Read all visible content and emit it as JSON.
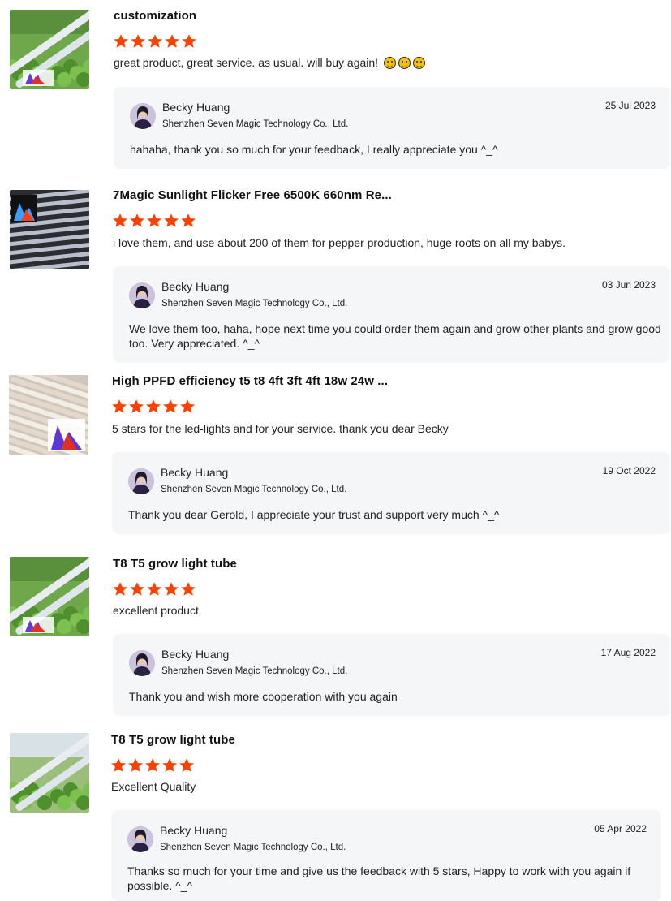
{
  "colors": {
    "star": "#ff4000",
    "reply_bg": "#f5f6f8"
  },
  "reviews": [
    {
      "title": "customization",
      "rating": 5,
      "comment": "great product, great service. as usual. will buy again!",
      "emoji_count": 3,
      "thumbnail_icon": "grow-light-tubes-with-plants",
      "reply": {
        "name": "Becky Huang",
        "company": "Shenzhen Seven Magic Technology Co., Ltd.",
        "date": "25 Jul 2023",
        "text_lines": [
          "hahaha, thank you so much for your feedback, I really appreciate you ^_^"
        ]
      }
    },
    {
      "title": "7Magic Sunlight Flicker Free 6500K 660nm Re...",
      "rating": 5,
      "comment": "i love them, and use about 200 of them for pepper production, huge roots on all my babys.",
      "emoji_count": 0,
      "thumbnail_icon": "grow-light-bars-dark",
      "reply": {
        "name": "Becky Huang",
        "company": "Shenzhen Seven Magic Technology Co., Ltd.",
        "date": "03 Jun 2023",
        "text_lines": [
          "We love them too, haha, hope next time you could order them again and grow other plants and grow good",
          "too. Very appreciated. ^_^"
        ]
      }
    },
    {
      "title": "High PPFD efficiency t5 t8 4ft 3ft 4ft 18w 24w ...",
      "rating": 5,
      "comment": "5 stars for the led-lights and for your service. thank you dear Becky",
      "emoji_count": 0,
      "thumbnail_icon": "stacked-led-tubes",
      "reply": {
        "name": "Becky Huang",
        "company": "Shenzhen Seven Magic Technology Co., Ltd.",
        "date": "19 Oct 2022",
        "text_lines": [
          "Thank you dear Gerold, I appreciate your trust and support very much ^_^"
        ]
      }
    },
    {
      "title": "T8 T5 grow light tube",
      "rating": 5,
      "comment": "excellent product",
      "emoji_count": 0,
      "thumbnail_icon": "grow-light-tubes-with-plants",
      "reply": {
        "name": "Becky Huang",
        "company": "Shenzhen Seven Magic Technology Co., Ltd.",
        "date": "17 Aug 2022",
        "text_lines": [
          "Thank you and wish more cooperation with you again"
        ]
      }
    },
    {
      "title": "T8 T5 grow light tube",
      "rating": 5,
      "comment": "Excellent Quality",
      "emoji_count": 0,
      "thumbnail_icon": "grow-light-tubes-in-greenhouse",
      "reply": {
        "name": "Becky Huang",
        "company": "Shenzhen Seven Magic Technology Co., Ltd.",
        "date": "05 Apr 2022",
        "text_lines": [
          "Thanks so much for your time and give us the feedback with 5 stars, Happy to work with you again if",
          "possible. ^_^"
        ]
      }
    }
  ]
}
